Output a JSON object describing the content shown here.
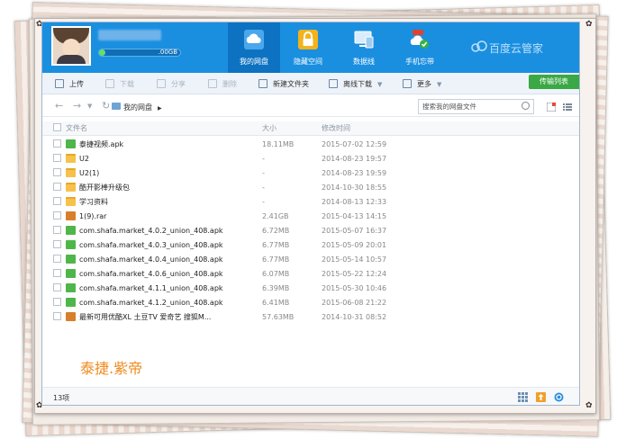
{
  "user": {
    "quota_text": ".00GB",
    "quota_used_fraction": 0.08
  },
  "nav_tabs": [
    {
      "label": "我的网盘",
      "icon": "cloud-icon",
      "active": true
    },
    {
      "label": "隐藏空间",
      "icon": "lock-icon",
      "active": false
    },
    {
      "label": "数据线",
      "icon": "monitor-icon",
      "active": false
    },
    {
      "label": "手机忘带",
      "icon": "phone-cloud-icon",
      "active": false
    }
  ],
  "brand": "百度云管家",
  "toolbar": {
    "upload": "上传",
    "download": "下载",
    "share": "分享",
    "delete": "删除",
    "new_folder": "新建文件夹",
    "offline_download": "离线下载",
    "more": "更多",
    "transfer_list": "传输列表"
  },
  "address": {
    "crumb": "我的网盘",
    "search_placeholder": "搜索我的网盘文件"
  },
  "columns": {
    "name": "文件名",
    "size": "大小",
    "time": "修改时间"
  },
  "files": [
    {
      "name": "泰捷视频.apk",
      "size": "18.11MB",
      "time": "2015-07-02 12:59",
      "type": "apk"
    },
    {
      "name": "U2",
      "size": "-",
      "time": "2014-08-23 19:57",
      "type": "folder"
    },
    {
      "name": "U2(1)",
      "size": "-",
      "time": "2014-08-23 19:59",
      "type": "folder"
    },
    {
      "name": "酷开影棒升级包",
      "size": "-",
      "time": "2014-10-30 18:55",
      "type": "folder"
    },
    {
      "name": "学习资料",
      "size": "-",
      "time": "2014-08-13 12:33",
      "type": "folder"
    },
    {
      "name": "1(9).rar",
      "size": "2.41GB",
      "time": "2015-04-13 14:15",
      "type": "rar"
    },
    {
      "name": "com.shafa.market_4.0.2_union_408.apk",
      "size": "6.72MB",
      "time": "2015-05-07 16:37",
      "type": "apk"
    },
    {
      "name": "com.shafa.market_4.0.3_union_408.apk",
      "size": "6.77MB",
      "time": "2015-05-09 20:01",
      "type": "apk"
    },
    {
      "name": "com.shafa.market_4.0.4_union_408.apk",
      "size": "6.77MB",
      "time": "2015-05-14 10:57",
      "type": "apk"
    },
    {
      "name": "com.shafa.market_4.0.6_union_408.apk",
      "size": "6.07MB",
      "time": "2015-05-22 12:24",
      "type": "apk"
    },
    {
      "name": "com.shafa.market_4.1.1_union_408.apk",
      "size": "6.39MB",
      "time": "2015-05-30 10:46",
      "type": "apk"
    },
    {
      "name": "com.shafa.market_4.1.2_union_408.apk",
      "size": "6.41MB",
      "time": "2015-06-08 21:22",
      "type": "apk"
    },
    {
      "name": "最新可用优酷XL 土豆TV 爱奇艺 搜狐M...",
      "size": "57.63MB",
      "time": "2014-10-31 08:52",
      "type": "rar"
    }
  ],
  "watermark": "泰捷.紫帝",
  "status": {
    "count": "13项"
  },
  "colors": {
    "header_blue": "#1a8fe0",
    "active_tab": "#0d72c2",
    "transfer_green": "#3aa845",
    "watermark_orange": "#ef8c1f"
  }
}
